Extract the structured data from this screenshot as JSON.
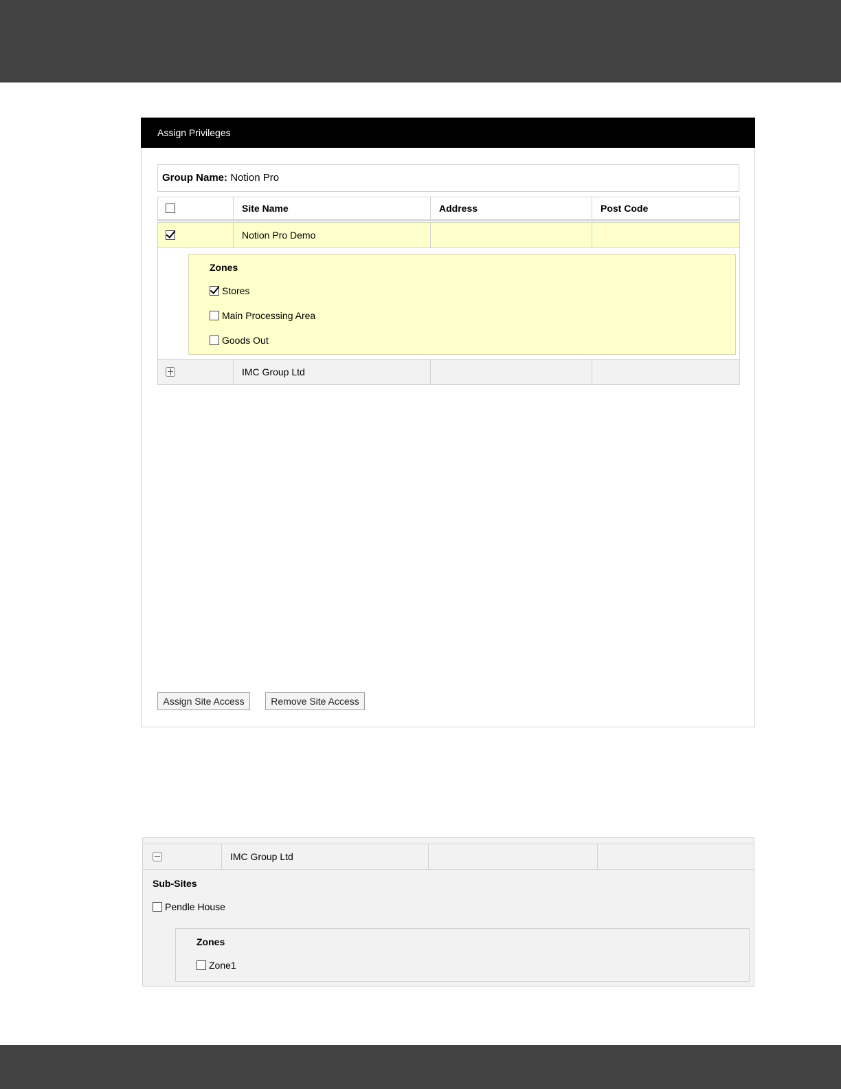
{
  "panel": {
    "title": "Assign Privileges",
    "group_label": "Group Name:",
    "group_value": "Notion Pro"
  },
  "table": {
    "headers": [
      "",
      "Site Name",
      "Address",
      "Post Code"
    ],
    "rows": [
      {
        "site_name": "Notion Pro Demo",
        "address": "",
        "post_code": "",
        "checked": true
      },
      {
        "site_name": "IMC Group Ltd",
        "address": "",
        "post_code": "",
        "expand": "+"
      }
    ]
  },
  "zones": {
    "title": "Zones",
    "items": [
      {
        "label": "Stores",
        "checked": true
      },
      {
        "label": "Main Processing Area",
        "checked": false
      },
      {
        "label": "Goods Out",
        "checked": false
      }
    ]
  },
  "buttons": {
    "assign": "Assign Site Access",
    "remove": "Remove Site Access"
  },
  "expanded": {
    "site_name": "IMC Group Ltd",
    "subsites_title": "Sub-Sites",
    "subsite": "Pendle House",
    "zones_title": "Zones",
    "zone": "Zone1"
  }
}
